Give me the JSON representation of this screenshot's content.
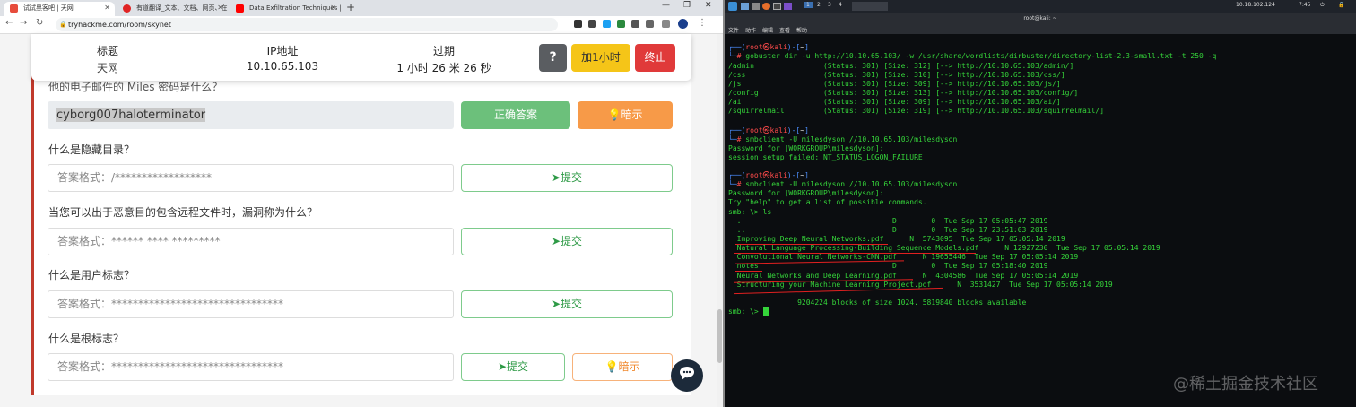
{
  "browser": {
    "tabs": [
      {
        "label": "试试黑客吧 | 天网"
      },
      {
        "label": "有道翻译_文本、文档、网页、在..."
      },
      {
        "label": "Data Exfiltration Techniques |..."
      }
    ],
    "new_tab": "+",
    "url": "tryhackme.com/room/skynet",
    "window_controls": [
      "—",
      "❐",
      "✕"
    ]
  },
  "room": {
    "title_header": "标题",
    "title_value": "天网",
    "ip_header": "IP地址",
    "ip_value": "10.10.65.103",
    "expire_header": "过期",
    "expire_value": "1 小时 26 米 26 秒",
    "help_label": "?",
    "add_hour_label": "加1小时",
    "terminate_label": "终止"
  },
  "questions": {
    "q0_partial": "他的电子邮件的 Miles 密码是什么？",
    "q0_answer": "cyborg007haloterminator",
    "q0_correct_label": "正确答案",
    "q0_hint_label": "暗示",
    "q1_text": "什么是隐藏目录？",
    "q1_placeholder": "答案格式：/******************",
    "q1_submit": "提交",
    "q2_text": "当您可以出于恶意目的包含远程文件时，漏洞称为什么？",
    "q2_placeholder": "答案格式：****** **** *********",
    "q2_submit": "提交",
    "q3_text": "什么是用户标志？",
    "q3_placeholder": "答案格式：********************************",
    "q3_submit": "提交",
    "q4_text": "什么是根标志？",
    "q4_placeholder": "答案格式：********************************",
    "q4_submit": "提交",
    "q4_hint": "暗示"
  },
  "desktop": {
    "workspaces": [
      "1",
      "2",
      "3",
      "4"
    ],
    "ip": "10.18.102.124",
    "clock": "7:45",
    "term_title": "root@kali: ~",
    "term_menu": [
      "文件",
      "动作",
      "编辑",
      "查看",
      "帮助"
    ]
  },
  "terminal": {
    "p1_user": "root㉿kali",
    "p1_cmd": "gobuster dir -u http://10.10.65.103/ -w /usr/share/wordlists/dirbuster/directory-list-2.3-small.txt -t 250 -q",
    "g1": "/admin                (Status: 301) [Size: 312] [--> http://10.10.65.103/admin/]",
    "g2": "/css                  (Status: 301) [Size: 310] [--> http://10.10.65.103/css/]",
    "g3": "/js                   (Status: 301) [Size: 309] [--> http://10.10.65.103/js/]",
    "g4": "/config               (Status: 301) [Size: 313] [--> http://10.10.65.103/config/]",
    "g5": "/ai                   (Status: 301) [Size: 309] [--> http://10.10.65.103/ai/]",
    "g6": "/squirrelmail         (Status: 301) [Size: 319] [--> http://10.10.65.103/squirrelmail/]",
    "p2_cmd": "smbclient -U milesdyson //10.10.65.103/milesdyson",
    "s1": "Password for [WORKGROUP\\milesdyson]:",
    "s2": "session setup failed: NT_STATUS_LOGON_FAILURE",
    "p3_cmd": "smbclient -U milesdyson //10.10.65.103/milesdyson",
    "t1": "Password for [WORKGROUP\\milesdyson]:",
    "t2": "Try \"help\" to get a list of possible commands.",
    "t3": "smb: \\> ls",
    "f1": "  .                                   D        0  Tue Sep 17 05:05:47 2019",
    "f2": "  ..                                  D        0  Tue Sep 17 23:51:03 2019",
    "f3": "  Improving Deep Neural Networks.pdf      N  5743095  Tue Sep 17 05:05:14 2019",
    "f4": "  Natural Language Processing-Building Sequence Models.pdf      N 12927230  Tue Sep 17 05:05:14 2019",
    "f5": "  Convolutional Neural Networks-CNN.pdf      N 19655446  Tue Sep 17 05:05:14 2019",
    "f6": "  notes                               D        0  Tue Sep 17 05:18:40 2019",
    "f7": "  Neural Networks and Deep Learning.pdf      N  4304586  Tue Sep 17 05:05:14 2019",
    "f8": "  Structuring your Machine Learning Project.pdf      N  3531427  Tue Sep 17 05:05:14 2019",
    "blocks": "                9204224 blocks of size 1024. 5819840 blocks available",
    "final_prompt": "smb: \\> "
  },
  "watermark": "@稀土掘金技术社区",
  "colors": {
    "accent_green": "#2e9a46",
    "correct_green": "#6cc07b",
    "hint_orange": "#f79a48",
    "add_hour_yellow": "#f5c518",
    "terminate_red": "#e03a3a"
  }
}
